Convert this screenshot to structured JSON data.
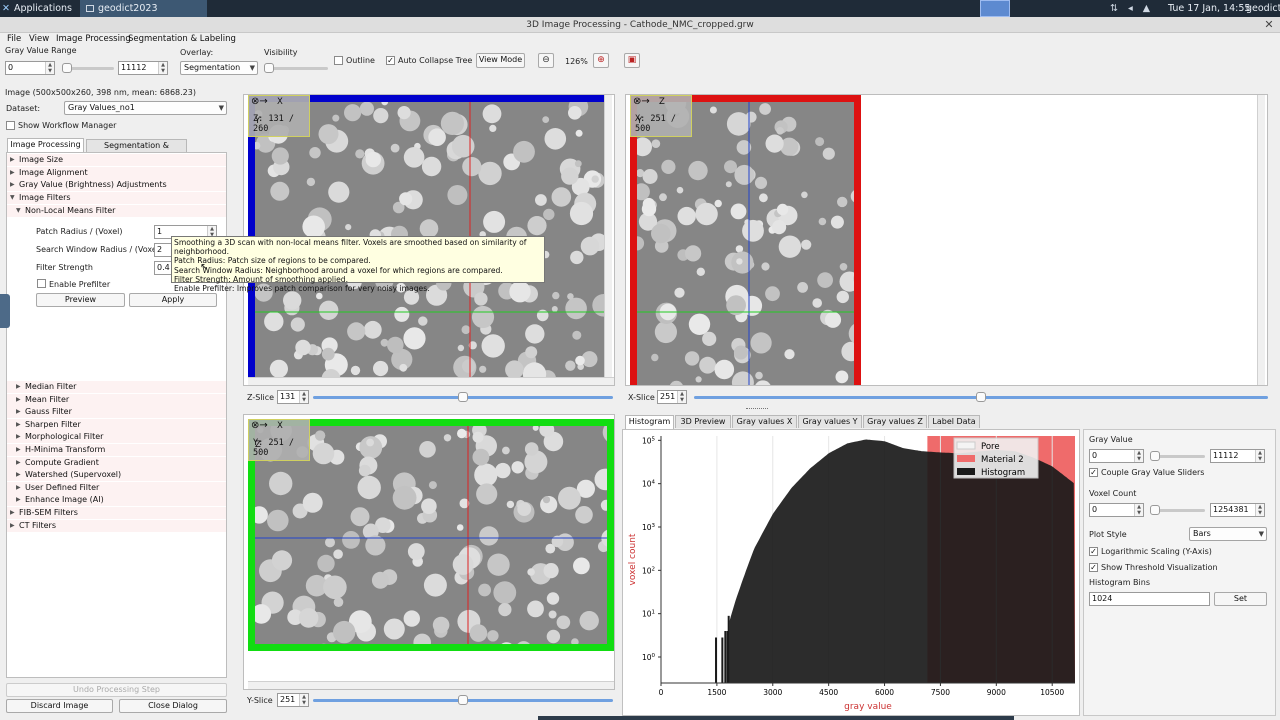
{
  "system": {
    "apps_label": "Applications",
    "task_label": "geodict2023",
    "clock": "Tue 17 Jan, 14:55",
    "user": "geodict"
  },
  "window": {
    "title": "3D Image Processing - Cathode_NMC_cropped.grw"
  },
  "menu": [
    "File",
    "View",
    "Image Processing",
    "Segmentation & Labeling"
  ],
  "toolbar": {
    "gray_range_label": "Gray Value Range",
    "gray_min": "0",
    "gray_max": "11112",
    "overlay_label": "Overlay:",
    "overlay_value": "Segmentation",
    "visibility_label": "Visibility",
    "outline_label": "Outline",
    "outline_checked": false,
    "autocollapse_label": "Auto Collapse Tree",
    "autocollapse_checked": true,
    "viewmode_label": "View Mode",
    "zoom": "126%"
  },
  "left": {
    "image_info": "Image (500x500x260, 398 nm, mean: 6868.23)",
    "dataset_label": "Dataset:",
    "dataset_value": "Gray Values_no1",
    "workflow_label": "Show Workflow Manager",
    "tabs": [
      "Image Processing",
      "Segmentation & Labeling"
    ],
    "tree_top": [
      "Image Size",
      "Image Alignment",
      "Gray Value (Brightness) Adjustments",
      "Image Filters"
    ],
    "nlm_label": "Non-Local Means Filter",
    "params": {
      "patch_label": "Patch Radius / (Voxel)",
      "patch_value": "1",
      "search_label": "Search Window Radius / (Voxel)",
      "search_value": "2",
      "strength_label": "Filter Strength",
      "strength_value": "0.4",
      "prefilter_label": "Enable Prefilter"
    },
    "preview_label": "Preview",
    "apply_label": "Apply",
    "filters": [
      "Median Filter",
      "Mean Filter",
      "Gauss Filter",
      "Sharpen Filter",
      "Morphological Filter",
      "H-Minima Transform",
      "Compute Gradient",
      "Watershed (Supervoxel)",
      "User Defined Filter",
      "Enhance Image (AI)"
    ],
    "tree_bottom": [
      "FIB-SEM Filters",
      "CT Filters"
    ],
    "undo_label": "Undo Processing Step",
    "discard_label": "Discard Image",
    "close_label": "Close Dialog"
  },
  "tooltip": [
    "Smoothing a 3D scan with non-local means filter. Voxels are smoothed based on similarity of neighborhood.",
    "Patch Radius: Patch size of regions to be compared.",
    "Search Window Radius: Neighborhood around a voxel for which regions are compared.",
    "Filter Strength: Amount of smoothing applied.",
    "Enable Prefilter: Improves patch comparison for very noisy images."
  ],
  "views": {
    "z": {
      "axis_h": "X",
      "axis_v": "Y",
      "info": "Z: 131 / 260",
      "slice_label": "Z-Slice",
      "slice_value": "131",
      "slice_fraction": 0.5,
      "frame_color": "#0000cc"
    },
    "x": {
      "axis_h": "Z",
      "axis_v": "Y",
      "info": "X: 251 / 500",
      "slice_label": "X-Slice",
      "slice_value": "251",
      "slice_fraction": 0.5,
      "frame_color": "#dd1111"
    },
    "y": {
      "axis_h": "X",
      "axis_v": "Z",
      "info": "Y: 251 / 500",
      "slice_label": "Y-Slice",
      "slice_value": "251",
      "slice_fraction": 0.5,
      "frame_color": "#11dd11"
    }
  },
  "hist_tabs": [
    "Histogram",
    "3D Preview",
    "Gray values X",
    "Gray values Y",
    "Gray values Z",
    "Label Data"
  ],
  "chart_data": {
    "type": "bar",
    "xlabel": "gray value",
    "ylabel": "voxel count",
    "xlim": [
      0,
      11112
    ],
    "ylim_log10": [
      -0.6,
      5.1
    ],
    "x_ticks": [
      "0",
      "1500",
      "3000",
      "4500",
      "6000",
      "7500",
      "9000",
      "10500"
    ],
    "y_ticks": [
      "10^0",
      "10^1",
      "10^2",
      "10^3",
      "10^4",
      "10^5"
    ],
    "log_scale_y": true,
    "legend": [
      "Pore",
      "Material 2",
      "Histogram"
    ],
    "legend_position": "top-right",
    "threshold": 7150,
    "colors": {
      "pore": "#f4f4f4",
      "material2": "#ef6b6b",
      "histogram": "#1a1a1a"
    },
    "x": [
      1450,
      1620,
      1760,
      2000,
      2200,
      2500,
      3000,
      3500,
      4000,
      4500,
      5000,
      5500,
      6000,
      6500,
      7000,
      7500,
      8000,
      8500,
      9000,
      9500,
      10000,
      10500,
      11100
    ],
    "log10_counts": [
      0.45,
      0.45,
      0.6,
      1.3,
      1.8,
      2.5,
      3.3,
      3.9,
      4.35,
      4.7,
      4.93,
      5.02,
      4.98,
      4.82,
      4.75,
      4.72,
      4.7,
      4.74,
      4.78,
      4.75,
      4.6,
      4.4,
      4.0
    ]
  },
  "hist_settings": {
    "gray_label": "Gray Value",
    "gray_min": "0",
    "gray_max": "11112",
    "couple_label": "Couple Gray Value Sliders",
    "voxel_label": "Voxel Count",
    "voxel_min": "0",
    "voxel_max": "1254381",
    "plot_style_label": "Plot Style",
    "plot_style_value": "Bars",
    "log_label": "Logarithmic Scaling (Y-Axis)",
    "thresh_label": "Show Threshold Visualization",
    "bins_label": "Histogram Bins",
    "bins_value": "1024",
    "set_label": "Set"
  }
}
